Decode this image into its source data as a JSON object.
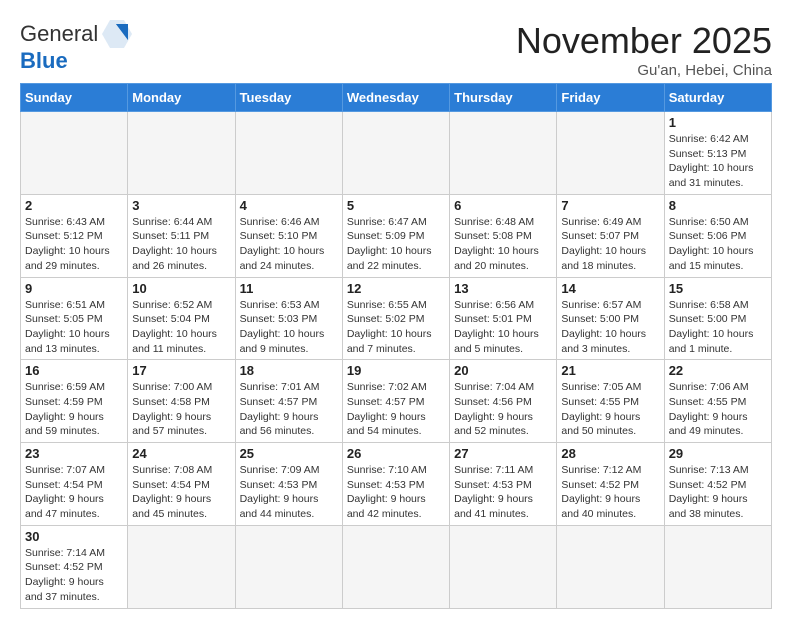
{
  "header": {
    "logo_general": "General",
    "logo_blue": "Blue",
    "month_title": "November 2025",
    "location": "Gu'an, Hebei, China"
  },
  "days_of_week": [
    "Sunday",
    "Monday",
    "Tuesday",
    "Wednesday",
    "Thursday",
    "Friday",
    "Saturday"
  ],
  "weeks": [
    [
      {
        "day": "",
        "info": ""
      },
      {
        "day": "",
        "info": ""
      },
      {
        "day": "",
        "info": ""
      },
      {
        "day": "",
        "info": ""
      },
      {
        "day": "",
        "info": ""
      },
      {
        "day": "",
        "info": ""
      },
      {
        "day": "1",
        "info": "Sunrise: 6:42 AM\nSunset: 5:13 PM\nDaylight: 10 hours and 31 minutes."
      }
    ],
    [
      {
        "day": "2",
        "info": "Sunrise: 6:43 AM\nSunset: 5:12 PM\nDaylight: 10 hours and 29 minutes."
      },
      {
        "day": "3",
        "info": "Sunrise: 6:44 AM\nSunset: 5:11 PM\nDaylight: 10 hours and 26 minutes."
      },
      {
        "day": "4",
        "info": "Sunrise: 6:46 AM\nSunset: 5:10 PM\nDaylight: 10 hours and 24 minutes."
      },
      {
        "day": "5",
        "info": "Sunrise: 6:47 AM\nSunset: 5:09 PM\nDaylight: 10 hours and 22 minutes."
      },
      {
        "day": "6",
        "info": "Sunrise: 6:48 AM\nSunset: 5:08 PM\nDaylight: 10 hours and 20 minutes."
      },
      {
        "day": "7",
        "info": "Sunrise: 6:49 AM\nSunset: 5:07 PM\nDaylight: 10 hours and 18 minutes."
      },
      {
        "day": "8",
        "info": "Sunrise: 6:50 AM\nSunset: 5:06 PM\nDaylight: 10 hours and 15 minutes."
      }
    ],
    [
      {
        "day": "9",
        "info": "Sunrise: 6:51 AM\nSunset: 5:05 PM\nDaylight: 10 hours and 13 minutes."
      },
      {
        "day": "10",
        "info": "Sunrise: 6:52 AM\nSunset: 5:04 PM\nDaylight: 10 hours and 11 minutes."
      },
      {
        "day": "11",
        "info": "Sunrise: 6:53 AM\nSunset: 5:03 PM\nDaylight: 10 hours and 9 minutes."
      },
      {
        "day": "12",
        "info": "Sunrise: 6:55 AM\nSunset: 5:02 PM\nDaylight: 10 hours and 7 minutes."
      },
      {
        "day": "13",
        "info": "Sunrise: 6:56 AM\nSunset: 5:01 PM\nDaylight: 10 hours and 5 minutes."
      },
      {
        "day": "14",
        "info": "Sunrise: 6:57 AM\nSunset: 5:00 PM\nDaylight: 10 hours and 3 minutes."
      },
      {
        "day": "15",
        "info": "Sunrise: 6:58 AM\nSunset: 5:00 PM\nDaylight: 10 hours and 1 minute."
      }
    ],
    [
      {
        "day": "16",
        "info": "Sunrise: 6:59 AM\nSunset: 4:59 PM\nDaylight: 9 hours and 59 minutes."
      },
      {
        "day": "17",
        "info": "Sunrise: 7:00 AM\nSunset: 4:58 PM\nDaylight: 9 hours and 57 minutes."
      },
      {
        "day": "18",
        "info": "Sunrise: 7:01 AM\nSunset: 4:57 PM\nDaylight: 9 hours and 56 minutes."
      },
      {
        "day": "19",
        "info": "Sunrise: 7:02 AM\nSunset: 4:57 PM\nDaylight: 9 hours and 54 minutes."
      },
      {
        "day": "20",
        "info": "Sunrise: 7:04 AM\nSunset: 4:56 PM\nDaylight: 9 hours and 52 minutes."
      },
      {
        "day": "21",
        "info": "Sunrise: 7:05 AM\nSunset: 4:55 PM\nDaylight: 9 hours and 50 minutes."
      },
      {
        "day": "22",
        "info": "Sunrise: 7:06 AM\nSunset: 4:55 PM\nDaylight: 9 hours and 49 minutes."
      }
    ],
    [
      {
        "day": "23",
        "info": "Sunrise: 7:07 AM\nSunset: 4:54 PM\nDaylight: 9 hours and 47 minutes."
      },
      {
        "day": "24",
        "info": "Sunrise: 7:08 AM\nSunset: 4:54 PM\nDaylight: 9 hours and 45 minutes."
      },
      {
        "day": "25",
        "info": "Sunrise: 7:09 AM\nSunset: 4:53 PM\nDaylight: 9 hours and 44 minutes."
      },
      {
        "day": "26",
        "info": "Sunrise: 7:10 AM\nSunset: 4:53 PM\nDaylight: 9 hours and 42 minutes."
      },
      {
        "day": "27",
        "info": "Sunrise: 7:11 AM\nSunset: 4:53 PM\nDaylight: 9 hours and 41 minutes."
      },
      {
        "day": "28",
        "info": "Sunrise: 7:12 AM\nSunset: 4:52 PM\nDaylight: 9 hours and 40 minutes."
      },
      {
        "day": "29",
        "info": "Sunrise: 7:13 AM\nSunset: 4:52 PM\nDaylight: 9 hours and 38 minutes."
      }
    ],
    [
      {
        "day": "30",
        "info": "Sunrise: 7:14 AM\nSunset: 4:52 PM\nDaylight: 9 hours and 37 minutes."
      },
      {
        "day": "",
        "info": ""
      },
      {
        "day": "",
        "info": ""
      },
      {
        "day": "",
        "info": ""
      },
      {
        "day": "",
        "info": ""
      },
      {
        "day": "",
        "info": ""
      },
      {
        "day": "",
        "info": ""
      }
    ]
  ]
}
